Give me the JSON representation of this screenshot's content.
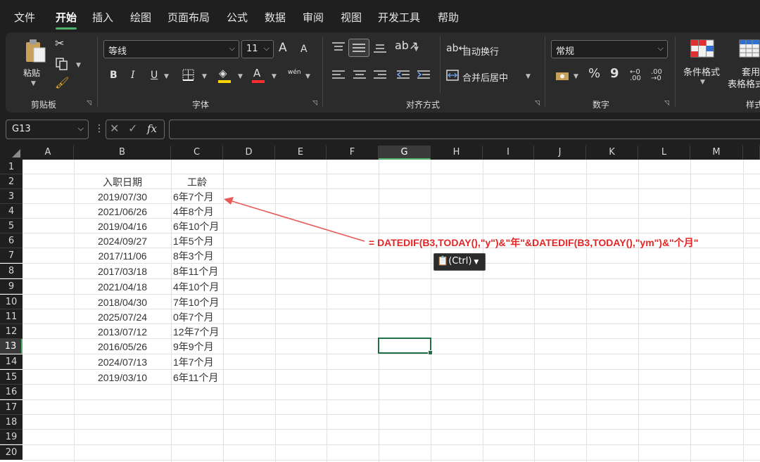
{
  "menu": {
    "items": [
      "文件",
      "开始",
      "插入",
      "绘图",
      "页面布局",
      "公式",
      "数据",
      "审阅",
      "视图",
      "开发工具",
      "帮助"
    ],
    "active_index": 1,
    "accent": "#4fb06b"
  },
  "ribbon": {
    "clipboard": {
      "paste_label": "粘贴",
      "group_label": "剪贴板"
    },
    "font": {
      "font_name": "等线",
      "font_size": "11",
      "group_label": "字体",
      "bold": "B",
      "italic": "I",
      "underline": "U",
      "grow": "A",
      "shrink": "A",
      "phonetic": "wén",
      "font_color": "#ff2d2d",
      "fill_color": "#ffd700"
    },
    "alignment": {
      "wrap_label": "自动换行",
      "merge_label": "合并后居中",
      "group_label": "对齐方式"
    },
    "number": {
      "format_value": "常规",
      "group_label": "数字",
      "percent": "%",
      "comma": "9"
    },
    "styles": {
      "conditional_label": "条件格式",
      "table_label_1": "套用",
      "table_label_2": "表格格式",
      "group_label": "样式"
    }
  },
  "formula_bar": {
    "name_box": "G13",
    "fx": "fx",
    "formula": ""
  },
  "sheet": {
    "columns": [
      "A",
      "B",
      "C",
      "D",
      "E",
      "F",
      "G",
      "H",
      "I",
      "J",
      "K",
      "L",
      "M"
    ],
    "selected_column": "G",
    "rows": [
      "1",
      "2",
      "3",
      "4",
      "5",
      "6",
      "7",
      "8",
      "9",
      "10",
      "11",
      "12",
      "13",
      "14",
      "15",
      "16",
      "17",
      "18",
      "19",
      "20"
    ],
    "selected_row": "13",
    "header_b": "入职日期",
    "header_c": "工龄",
    "data": [
      {
        "date": "2019/07/30",
        "tenure": "6年7个月"
      },
      {
        "date": "2021/06/26",
        "tenure": "4年8个月"
      },
      {
        "date": "2019/04/16",
        "tenure": "6年10个月"
      },
      {
        "date": "2024/09/27",
        "tenure": "1年5个月"
      },
      {
        "date": "2017/11/06",
        "tenure": "8年3个月"
      },
      {
        "date": "2017/03/18",
        "tenure": "8年11个月"
      },
      {
        "date": "2021/04/18",
        "tenure": "4年10个月"
      },
      {
        "date": "2018/04/30",
        "tenure": "7年10个月"
      },
      {
        "date": "2025/07/24",
        "tenure": "0年7个月"
      },
      {
        "date": "2013/07/12",
        "tenure": "12年7个月"
      },
      {
        "date": "2016/05/26",
        "tenure": "9年9个月"
      },
      {
        "date": "2024/07/13",
        "tenure": "1年7个月"
      },
      {
        "date": "2019/03/10",
        "tenure": "6年11个月"
      }
    ],
    "annotation": "=  DATEDIF(B3,TODAY(),\"y\")&\"年\"&DATEDIF(B3,TODAY(),\"ym\")&\"个月\"",
    "annotation_color": "#e52525",
    "paste_options_label": "(Ctrl)"
  }
}
